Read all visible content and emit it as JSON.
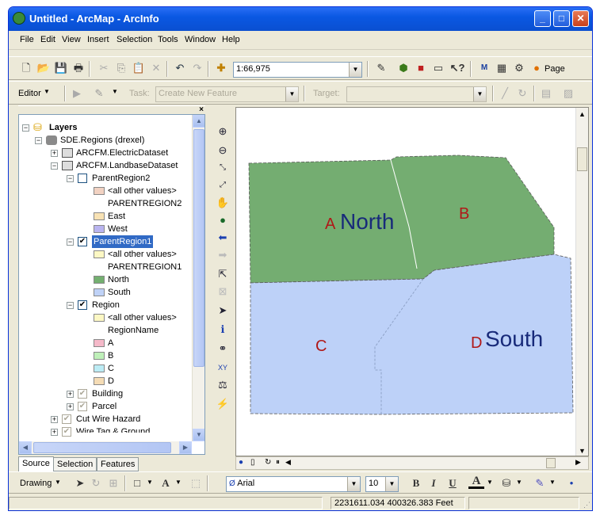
{
  "window": {
    "title": "Untitled - ArcMap - ArcInfo"
  },
  "menu": [
    "File",
    "Edit",
    "View",
    "Insert",
    "Selection",
    "Tools",
    "Window",
    "Help"
  ],
  "toolbar": {
    "scale": "1:66,975",
    "page_label": "Page"
  },
  "editor": {
    "editor_label": "Editor",
    "task_label": "Task:",
    "task_value": "Create New Feature",
    "target_label": "Target:",
    "target_value": ""
  },
  "toc": {
    "root": "Layers",
    "items": [
      {
        "label": "SDE.Regions (drexel)"
      },
      {
        "label": "ARCFM.ElectricDataset"
      },
      {
        "label": "ARCFM.LandbaseDataset"
      },
      {
        "label": "ParentRegion2"
      },
      {
        "label": "<all other values>"
      },
      {
        "label": "PARENTREGION2"
      },
      {
        "label": "East"
      },
      {
        "label": "West"
      },
      {
        "label": "ParentRegion1"
      },
      {
        "label": "<all other values>"
      },
      {
        "label": "PARENTREGION1"
      },
      {
        "label": "North"
      },
      {
        "label": "South"
      },
      {
        "label": "Region"
      },
      {
        "label": "<all other values>"
      },
      {
        "label": "RegionName"
      },
      {
        "label": "A"
      },
      {
        "label": "B"
      },
      {
        "label": "C"
      },
      {
        "label": "D"
      },
      {
        "label": "Building"
      },
      {
        "label": "Parcel"
      },
      {
        "label": "Cut Wire Hazard"
      },
      {
        "label": "Wire Tag & Ground"
      }
    ],
    "swatch_colors": {
      "all_other_2": "#f2d2c2",
      "east": "#f8e2b4",
      "west": "#b9b4f0",
      "all_other_1": "#fdf8c4",
      "north": "#74b070",
      "south": "#bfd2f7",
      "all_other_r": "#fdf8c4",
      "a": "#f5b9c9",
      "b": "#bff0b9",
      "c": "#bcecf5",
      "d": "#f5dcb5"
    }
  },
  "tabs": [
    "Source",
    "Selection",
    "Features"
  ],
  "map": {
    "labels": {
      "a_letter": "A",
      "north": "North",
      "b_letter": "B",
      "c_letter": "C",
      "d_letter": "D",
      "south": "South"
    },
    "colors": {
      "north": "#74ad71",
      "south": "#bdd1f8",
      "letter": "#b01818",
      "region_name": "#182a7a"
    }
  },
  "drawing": {
    "drawing_label": "Drawing",
    "font": "Arial",
    "font_size": "10",
    "bold": "B",
    "italic": "I",
    "underline": "U",
    "text_a": "A"
  },
  "status": {
    "coords": "2231611.034  400326.383 Feet"
  }
}
